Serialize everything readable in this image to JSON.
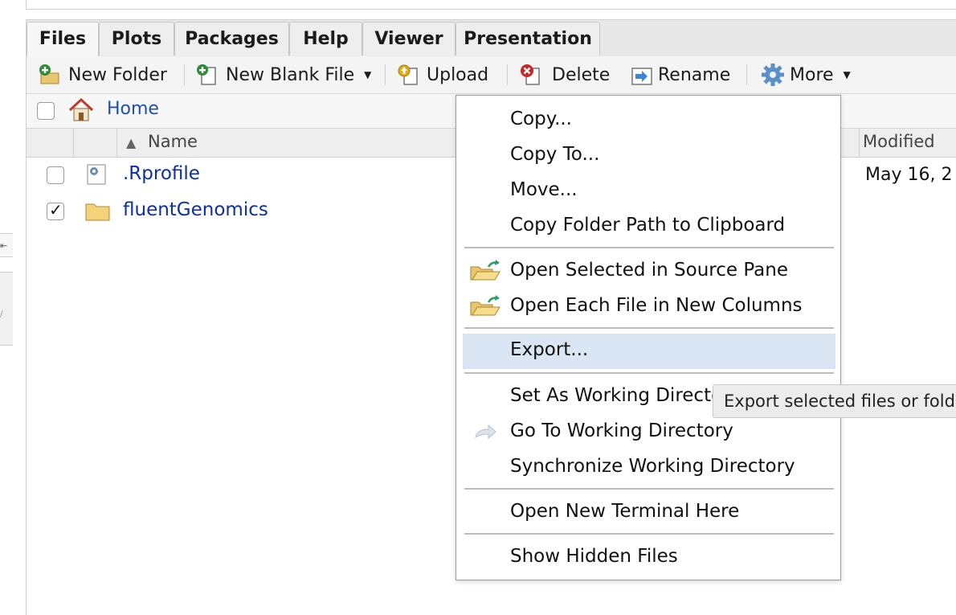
{
  "tabs": [
    {
      "label": "Files",
      "active": true
    },
    {
      "label": "Plots",
      "active": false
    },
    {
      "label": "Packages",
      "active": false
    },
    {
      "label": "Help",
      "active": false
    },
    {
      "label": "Viewer",
      "active": false
    },
    {
      "label": "Presentation",
      "active": false
    }
  ],
  "toolbar": {
    "new_folder": "New Folder",
    "new_blank_file": "New Blank File",
    "upload": "Upload",
    "delete": "Delete",
    "rename": "Rename",
    "more": "More"
  },
  "breadcrumb": {
    "home": "Home"
  },
  "columns": {
    "name": "Name",
    "modified": "Modified",
    "sort_indicator": "ascending"
  },
  "files": [
    {
      "name": ".Rprofile",
      "modified": "May 16, 2",
      "checked": false,
      "icon": "r-profile-file-icon"
    },
    {
      "name": "fluentGenomics",
      "modified": "",
      "checked": true,
      "icon": "folder-icon"
    }
  ],
  "menu": {
    "items": [
      {
        "label": "Copy..."
      },
      {
        "label": "Copy To..."
      },
      {
        "label": "Move..."
      },
      {
        "label": "Copy Folder Path to Clipboard"
      },
      {
        "label": "Open Selected in Source Pane",
        "icon": "open-folder-icon"
      },
      {
        "label": "Open Each File in New Columns",
        "icon": "open-folder-icon"
      },
      {
        "label": "Export...",
        "highlighted": true
      },
      {
        "label": "Set As Working Directory"
      },
      {
        "label": "Go To Working Directory",
        "icon": "go-to-arrow-icon"
      },
      {
        "label": "Synchronize Working Directory"
      },
      {
        "label": "Open New Terminal Here"
      },
      {
        "label": "Show Hidden Files"
      }
    ]
  },
  "tooltip": "Export selected files or folders",
  "colors": {
    "link_blue": "#1a4fb5",
    "file_link": "#0f2f9e",
    "highlight": "#dbe6f4",
    "delete_red": "#c62828",
    "add_green": "#2e8b3a"
  }
}
